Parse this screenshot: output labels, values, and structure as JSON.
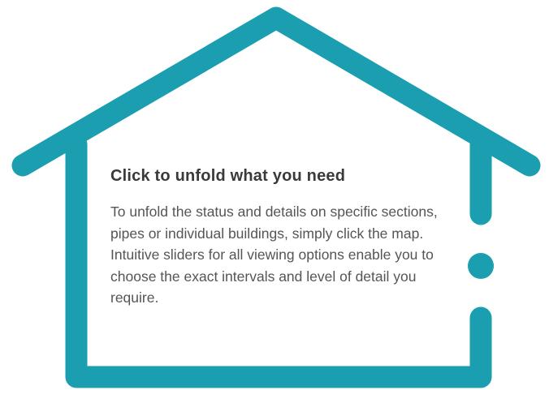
{
  "card": {
    "title": "Click to unfold what you need",
    "body": "To unfold the status and details on specific sections, pipes or individual buildings, simply click the map. Intuitive sliders for all viewing options enable you to choose the exact intervals and level of detail you require."
  },
  "colors": {
    "outline": "#1a9eb0",
    "title": "#3a3a3a",
    "text": "#555555",
    "background": "#ffffff"
  },
  "icons": {
    "frame": "house-outline-icon"
  }
}
